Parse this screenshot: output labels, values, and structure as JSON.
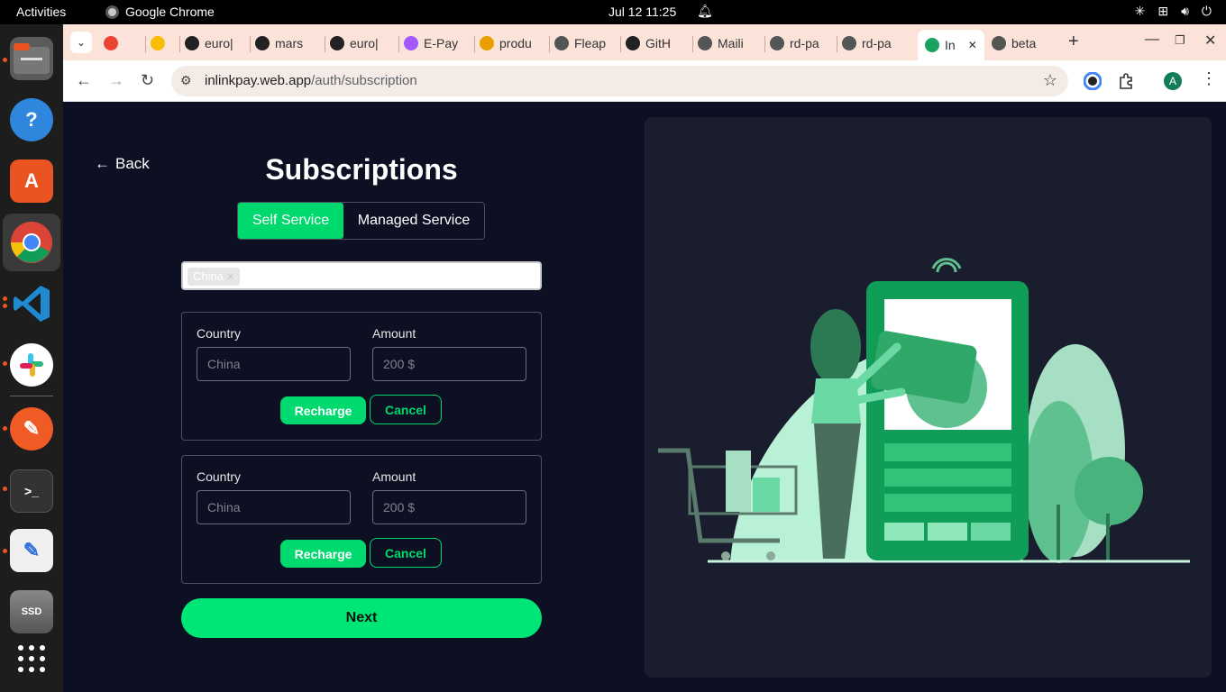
{
  "system": {
    "activities": "Activities",
    "app_name": "Google Chrome",
    "clock": "Jul 12  11:25"
  },
  "browser": {
    "tabs": [
      {
        "label": "",
        "icon": "gmail-icon",
        "color": "#ea4335"
      },
      {
        "label": "",
        "icon": "keep-icon",
        "color": "#fbbc04"
      },
      {
        "label": "euro|",
        "icon": "github-icon",
        "color": "#222222"
      },
      {
        "label": "mars",
        "icon": "github-icon",
        "color": "#222222"
      },
      {
        "label": "euro|",
        "icon": "github-icon",
        "color": "#222222"
      },
      {
        "label": "E-Pay",
        "icon": "figma-icon",
        "color": "#a259ff"
      },
      {
        "label": "produ",
        "icon": "pma-icon",
        "color": "#e8a000"
      },
      {
        "label": "Fleap",
        "icon": "globe-icon",
        "color": "#555555"
      },
      {
        "label": "GitH",
        "icon": "github-icon",
        "color": "#222222"
      },
      {
        "label": "Maili",
        "icon": "globe-icon",
        "color": "#555555"
      },
      {
        "label": "rd-pa",
        "icon": "globe-icon",
        "color": "#555555"
      },
      {
        "label": "rd-pa",
        "icon": "globe-icon",
        "color": "#555555"
      },
      {
        "label": "In",
        "icon": "inlinkpay-icon",
        "color": "#1aa260",
        "active": true
      },
      {
        "label": "beta",
        "icon": "globe-icon",
        "color": "#555555"
      }
    ],
    "url_host": "inlinkpay.web.app",
    "url_path": "/auth/subscription",
    "profile_initial": "A"
  },
  "page": {
    "back_label": "Back",
    "title": "Subscriptions",
    "segment": {
      "selected": "Self Service",
      "other": "Managed Service"
    },
    "tags": [
      {
        "label": "China",
        "remove": "×"
      }
    ],
    "cards": [
      {
        "country_label": "Country",
        "country_placeholder": "China",
        "amount_label": "Amount",
        "amount_placeholder": "200 $",
        "recharge": "Recharge",
        "cancel": "Cancel"
      },
      {
        "country_label": "Country",
        "country_placeholder": "China",
        "amount_label": "Amount",
        "amount_placeholder": "200 $",
        "recharge": "Recharge",
        "cancel": "Cancel"
      }
    ],
    "next_label": "Next"
  },
  "colors": {
    "accent": "#00d96e",
    "background": "#0c1022",
    "panel": "#1a1d2e"
  }
}
